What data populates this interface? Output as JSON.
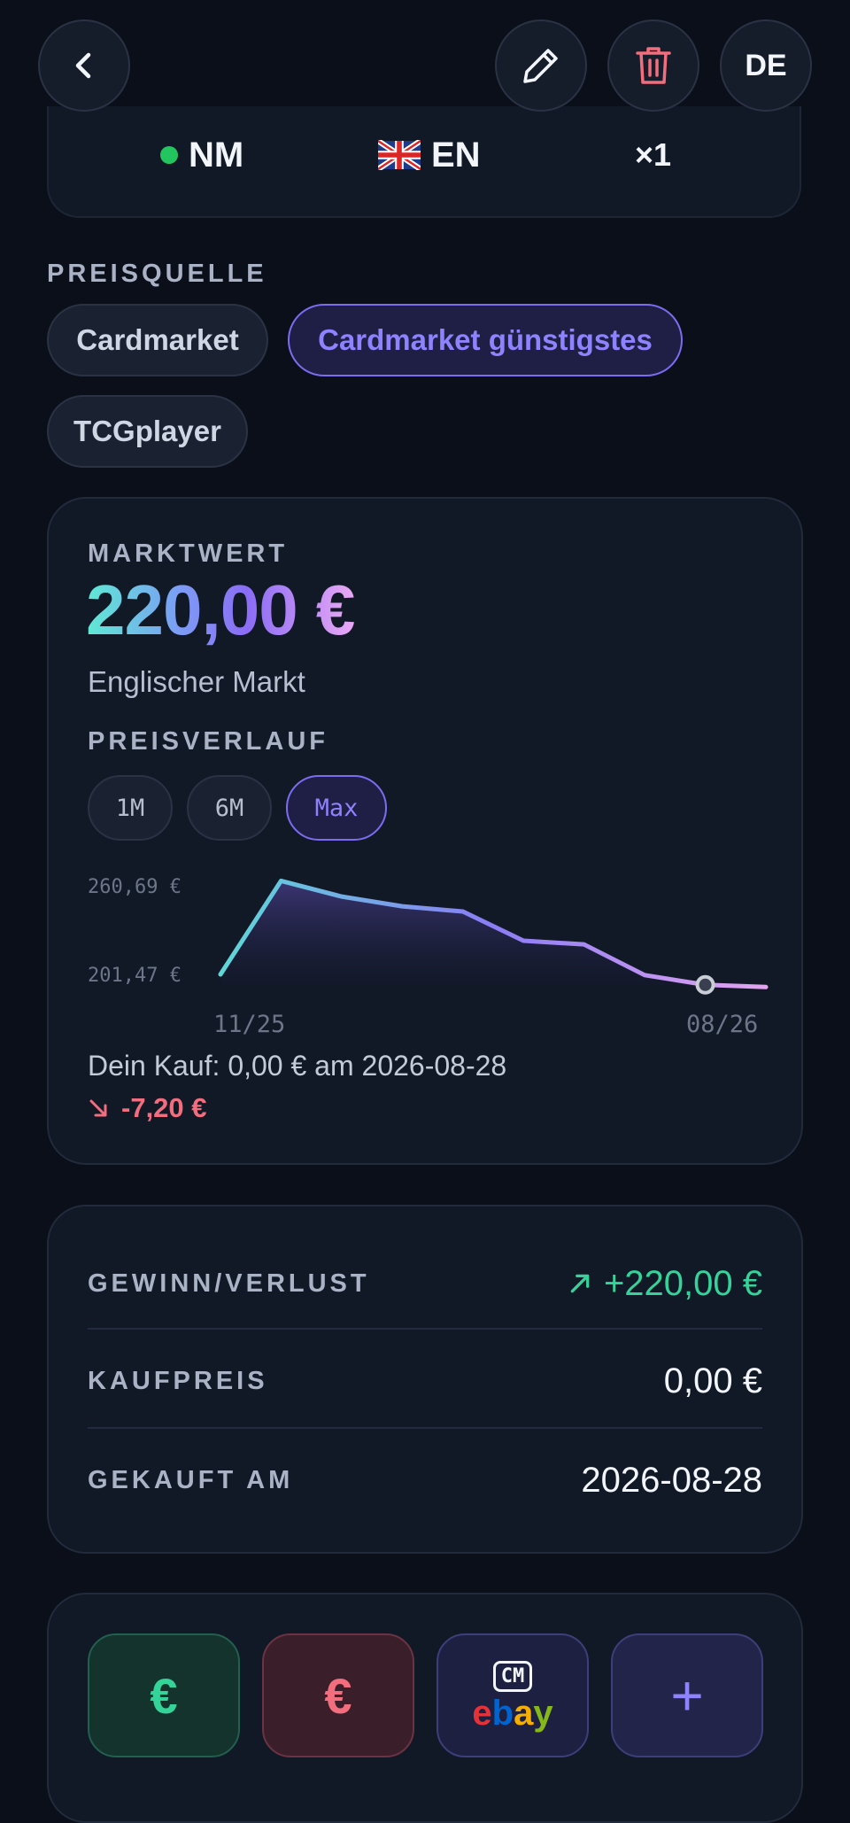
{
  "header": {
    "language": "DE"
  },
  "card_summary": {
    "condition": "NM",
    "language_label": "EN",
    "quantity": "×1"
  },
  "price_source": {
    "label": "PREISQUELLE",
    "options": [
      "Cardmarket",
      "Cardmarket günstigstes",
      "TCGplayer"
    ],
    "selected": "Cardmarket günstigstes"
  },
  "market": {
    "label": "MARKTWERT",
    "value": "220,00 €",
    "subtitle": "Englischer Markt",
    "history_label": "PREISVERLAUF",
    "ranges": [
      "1M",
      "6M",
      "Max"
    ],
    "selected_range": "Max",
    "purchase_text": "Dein Kauf: 0,00 € am 2026-08-28",
    "delta": "-7,20 €"
  },
  "chart_data": {
    "type": "area",
    "y_ticks": [
      "260,69 €",
      "201,47 €"
    ],
    "x_ticks": [
      "11/25",
      "08/26"
    ],
    "ylim": [
      201.47,
      260.69
    ],
    "values": [
      201.47,
      264.0,
      253.5,
      247.0,
      243.5,
      224.0,
      221.5,
      201.0,
      194.5,
      193.0
    ],
    "marker_index": 8,
    "colors": {
      "start": "#5ed8d8",
      "mid": "#8b7cf5",
      "end": "#e3a4f0"
    }
  },
  "profit": {
    "rows": [
      {
        "label": "GEWINN/VERLUST",
        "value": "+220,00 €"
      },
      {
        "label": "KAUFPREIS",
        "value": "0,00 €"
      },
      {
        "label": "GEKAUFT AM",
        "value": "2026-08-28"
      }
    ]
  },
  "actions": {
    "buy_symbol": "€",
    "sell_symbol": "€",
    "cm_label": "CM",
    "ebay_letters": [
      "e",
      "b",
      "a",
      "y"
    ],
    "add_symbol": "+"
  },
  "colors": {
    "background": "#0a0f1a",
    "card": "#111826",
    "accent": "#7c6cf0",
    "positive": "#34d399",
    "negative": "#f26d7d",
    "trash": "#f26d7d"
  }
}
